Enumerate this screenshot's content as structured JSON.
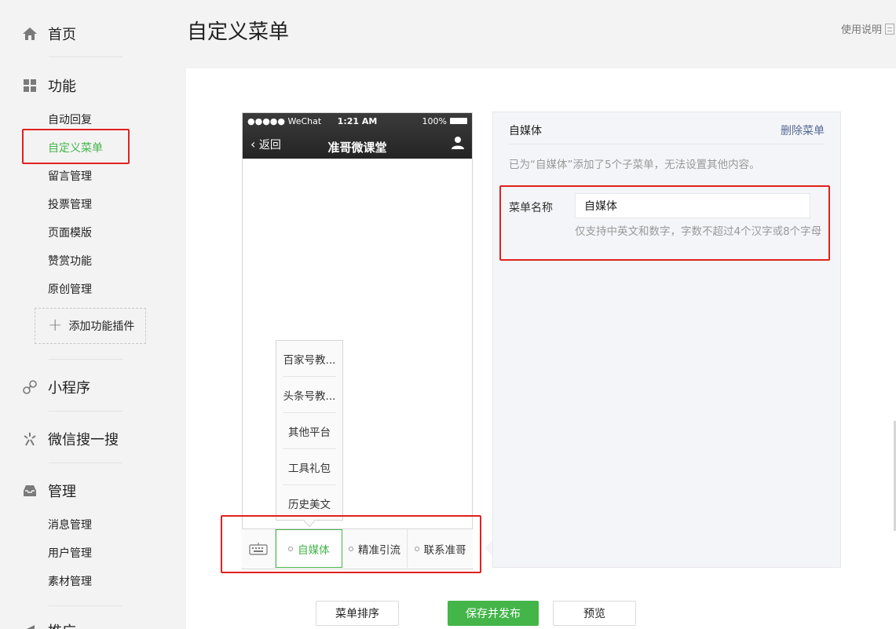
{
  "sidebar": {
    "home": "首页",
    "features": "功能",
    "feature_items": [
      "自动回复",
      "自定义菜单",
      "留言管理",
      "投票管理",
      "页面模版",
      "赞赏功能",
      "原创管理"
    ],
    "add_plugin": "添加功能插件",
    "mini_program": "小程序",
    "wechat_search": "微信搜一搜",
    "manage": "管理",
    "manage_items": [
      "消息管理",
      "用户管理",
      "素材管理"
    ],
    "promotion": "推广"
  },
  "header": {
    "title": "自定义菜单",
    "help": "使用说明"
  },
  "phone": {
    "carrier": "●●●●● WeChat",
    "time": "1:21 AM",
    "battery": "100%",
    "back": "返回",
    "account_name": "准哥微课堂",
    "submenu": [
      "百家号教...",
      "头条号教...",
      "其他平台",
      "工具礼包",
      "历史美文"
    ],
    "menu_tabs": [
      "自媒体",
      "精准引流",
      "联系准哥"
    ]
  },
  "editor": {
    "menu_title": "自媒体",
    "delete_label": "删除菜单",
    "info": "已为“自媒体”添加了5个子菜单，无法设置其他内容。",
    "name_label": "菜单名称",
    "name_value": "自媒体",
    "hint": "仅支持中英文和数字，字数不超过4个汉字或8个字母"
  },
  "buttons": {
    "sort": "菜单排序",
    "save_publish": "保存并发布",
    "preview": "预览"
  },
  "colors": {
    "accent_green": "#44b549",
    "highlight_red": "#e0221f",
    "link_blue": "#576b95"
  }
}
